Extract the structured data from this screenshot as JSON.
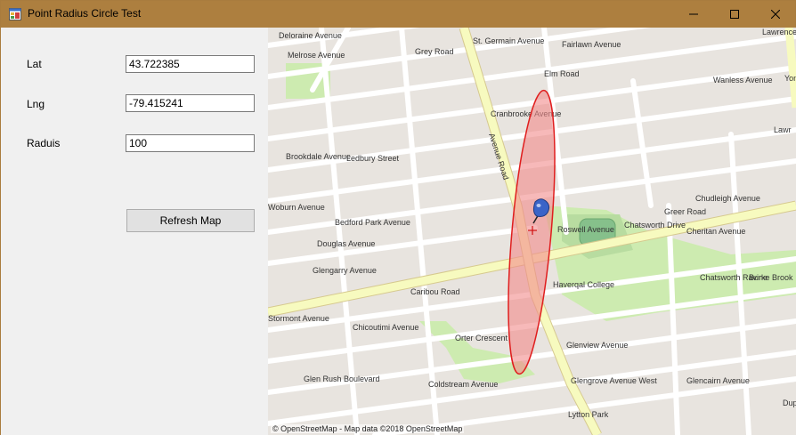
{
  "window": {
    "title": "Point Radius Circle Test"
  },
  "form": {
    "lat_label": "Lat",
    "lat_value": "43.722385",
    "lng_label": "Lng",
    "lng_value": "-79.415241",
    "radius_label": "Raduis",
    "radius_value": "100",
    "refresh_label": "Refresh Map"
  },
  "map": {
    "attribution": "© OpenStreetMap - Map data ©2018 OpenStreetMap",
    "streets": [
      "Deloraine Avenue",
      "Melrose Avenue",
      "St. Germain Avenue",
      "Fairlawn Avenue",
      "Brookdale Avenue",
      "Cranbrooke Avenue",
      "Woburn Avenue",
      "Bedford Park Avenue",
      "Douglas Avenue",
      "Glengarry Avenue",
      "Avenue Road",
      "Grey Road",
      "Elm Road",
      "Ledbury Street",
      "Chatsworth Drive",
      "Cheritan Avenue",
      "Chudleigh Avenue",
      "Roswell Avenue",
      "Greer Road",
      "Caribou Road",
      "Orter Crescent",
      "Glenview Avenue",
      "Glengrove Avenue West",
      "Glencairn Avenue",
      "Coldstream Avenue",
      "Lytton Park",
      "Haverqal College",
      "Chatsworth Ravine",
      "Burke Brook",
      "Stormont Avenue",
      "Chicoutimi Avenue",
      "Glen Rush Boulevard",
      "Lawrence Park",
      "Wanless Avenue",
      "Yonge Street",
      "Lawr",
      "Dupl"
    ]
  },
  "colors": {
    "titlebar": "#ad7f3f",
    "map_bg": "#e8e4df",
    "major_road": "#f7fabf",
    "circle_fill": "#f28b8b",
    "circle_stroke": "#e01e1e",
    "park": "#cdebb0",
    "pin": "#3a64c8"
  },
  "icons": [
    "app-icon",
    "minimize-icon",
    "maximize-icon",
    "close-icon",
    "map-pin-icon",
    "crosshair-icon"
  ]
}
